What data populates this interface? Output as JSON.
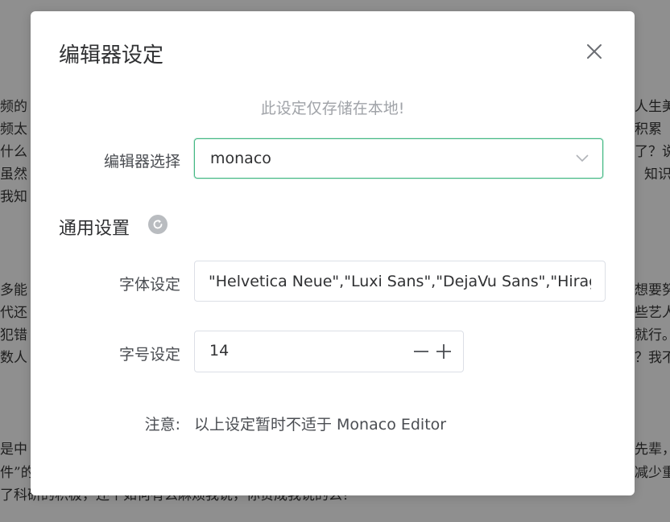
{
  "background_text": [
    "频的",
    "频太",
    "什么",
    "虽然",
    "我知",
    "多能",
    "代还",
    "犯错",
    "数人",
    "是中",
    "件”的",
    "了科研的积极，还个如何有么麻烦我说，你赞成我说的么？",
    "人生美",
    "积累",
    "了？说",
    "知识",
    "想要努",
    "些艺人",
    "就行。",
    "？我不",
    "先辈，",
    "减少重"
  ],
  "dialog": {
    "title": "编辑器设定",
    "notice": "此设定仅存储在本地!",
    "editor_select": {
      "label": "编辑器选择",
      "value": "monaco"
    },
    "section_title": "通用设置",
    "font_setting": {
      "label": "字体设定",
      "value": "\"Helvetica Neue\",\"Luxi Sans\",\"DejaVu Sans\",\"Hiragino Sans GB\""
    },
    "size_setting": {
      "label": "字号设定",
      "value": "14"
    },
    "note": {
      "label": "注意:",
      "text": "以上设定暂时不适于 Monaco Editor"
    }
  },
  "colors": {
    "accent": "#42b883",
    "overlay": "#8f8f8f",
    "dialog_bg": "#ffffff"
  },
  "icons": {
    "close": "close-icon",
    "chevron": "chevron-down-icon",
    "refresh": "refresh-icon",
    "minus": "minus-icon",
    "plus": "plus-icon"
  }
}
